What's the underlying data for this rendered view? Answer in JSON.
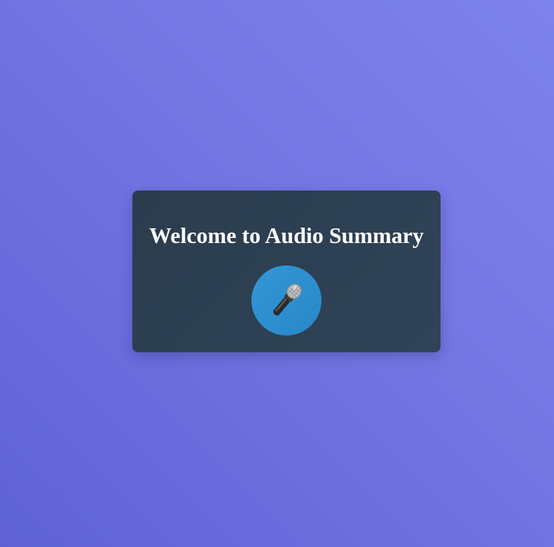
{
  "welcome": {
    "title": "Welcome to Audio Summary",
    "record_button": {
      "icon": "microphone-icon"
    }
  },
  "colors": {
    "background_start": "#7e82ec",
    "background_end": "#5f62d6",
    "card": "#2e4154",
    "button": "#2e8fcf",
    "title_text": "#ffffff"
  }
}
